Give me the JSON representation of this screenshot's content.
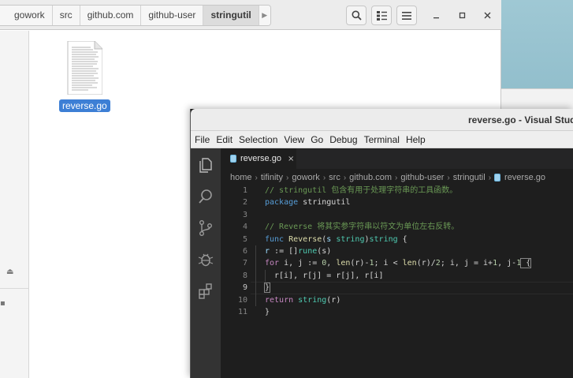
{
  "file_manager": {
    "breadcrumbs": [
      "gowork",
      "src",
      "github.com",
      "github-user",
      "stringutil"
    ],
    "active_crumb": "stringutil",
    "file": {
      "name": "reverse.go"
    },
    "icons": [
      "search-icon",
      "view-toggle-icon",
      "menu-icon",
      "minimize-icon",
      "maximize-icon",
      "close-icon",
      "eject-icon"
    ]
  },
  "vscode": {
    "title": "reverse.go - Visual Studi",
    "menu": [
      "File",
      "Edit",
      "Selection",
      "View",
      "Go",
      "Debug",
      "Terminal",
      "Help"
    ],
    "tab": {
      "name": "reverse.go",
      "close": "×"
    },
    "breadcrumb": [
      "home",
      "tifinity",
      "gowork",
      "src",
      "github.com",
      "github-user",
      "stringutil",
      "reverse.go"
    ],
    "line_numbers": [
      "1",
      "2",
      "3",
      "4",
      "5",
      "6",
      "7",
      "8",
      "9",
      "10",
      "11"
    ],
    "active_line": 9,
    "code": {
      "l1": "// stringutil 包含有用于处理字符串的工具函数。",
      "l2_kw": "package",
      "l2_name": " stringutil",
      "l4": "// Reverse 将其实参字符串以符文为单位左右反转。",
      "l5_kw": "func",
      "l5_fn": " Reverse",
      "l5_a": "(",
      "l5_param": "s",
      "l5_type1": " string",
      "l5_b": ")",
      "l5_type2": "string",
      "l5_c": " {",
      "l6_var": "r",
      "l6_op": " := []",
      "l6_fn": "rune",
      "l6_end": "(s)",
      "l7_kw": "for",
      "l7_a": " i, j := ",
      "l7_n0": "0",
      "l7_b": ", ",
      "l7_fn": "len",
      "l7_c": "(r)-",
      "l7_n1": "1",
      "l7_d": "; i < ",
      "l7_fn2": "len",
      "l7_e": "(r)/",
      "l7_n2": "2",
      "l7_f": "; i, j = i+",
      "l7_n3": "1",
      "l7_g": ", j-",
      "l7_n4": "1",
      "l7_h": " {",
      "l8": "r[i], r[j] = r[j], r[i]",
      "l9": "}",
      "l10_kw": "return",
      "l10_fn": " string",
      "l10_end": "(r)",
      "l11": "}"
    },
    "icons": [
      "explorer-icon",
      "search-icon",
      "source-control-icon",
      "debug-icon",
      "extensions-icon",
      "go-file-icon"
    ]
  }
}
